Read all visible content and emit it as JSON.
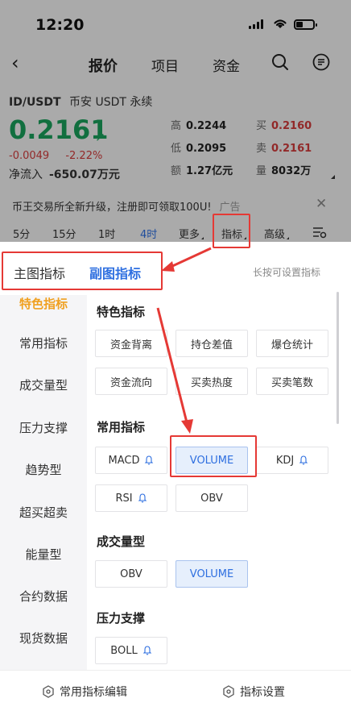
{
  "status_bar": {
    "time": "12:20"
  },
  "nav": {
    "tabs": [
      "报价",
      "项目",
      "资金"
    ]
  },
  "ticker": {
    "pair": "ID/USDT",
    "exchange": "币安 USDT 永续",
    "price": "0.2161",
    "change_abs": "-0.0049",
    "change_pct": "-2.22%",
    "netflow_label": "净流入",
    "netflow_value": "-650.07万元",
    "high_label": "高",
    "high": "0.2244",
    "low_label": "低",
    "low": "0.2095",
    "amount_label": "额",
    "amount": "1.27亿元",
    "buy_label": "买",
    "buy": "0.2160",
    "sell_label": "卖",
    "sell": "0.2161",
    "volume_label": "量",
    "volume": "8032万"
  },
  "ad": {
    "text": "币王交易所全新升级，注册即可领取100U!",
    "tag": "广告"
  },
  "intervals": [
    "5分",
    "15分",
    "1时",
    "4时",
    "更多",
    "指标",
    "高级"
  ],
  "selected_interval": "4时",
  "sheet": {
    "tabs": [
      "主图指标",
      "副图指标"
    ],
    "active_tab": "副图指标",
    "hint": "长按可设置指标",
    "left_nav": [
      "特色指标",
      "常用指标",
      "成交量型",
      "压力支撑",
      "趋势型",
      "超买超卖",
      "能量型",
      "合约数据",
      "现货数据"
    ],
    "active_left": "特色指标",
    "sections": [
      {
        "title": "特色指标",
        "items": [
          "资金背离",
          "持仓差值",
          "爆仓统计",
          "资金流向",
          "买卖热度",
          "买卖笔数"
        ]
      },
      {
        "title": "常用指标",
        "items": [
          "MACD",
          "VOLUME",
          "KDJ",
          "RSI",
          "OBV"
        ]
      },
      {
        "title": "成交量型",
        "items": [
          "OBV",
          "VOLUME"
        ]
      },
      {
        "title": "压力支撑",
        "items": [
          "BOLL"
        ]
      }
    ]
  },
  "bottom_bar": {
    "edit": "常用指标编辑",
    "settings": "指标设置"
  },
  "colors": {
    "accent": "#2e6fe0",
    "up": "#19a05b",
    "down": "#d23b3b",
    "highlight": "#e53935",
    "active_nav": "#f0a020"
  }
}
